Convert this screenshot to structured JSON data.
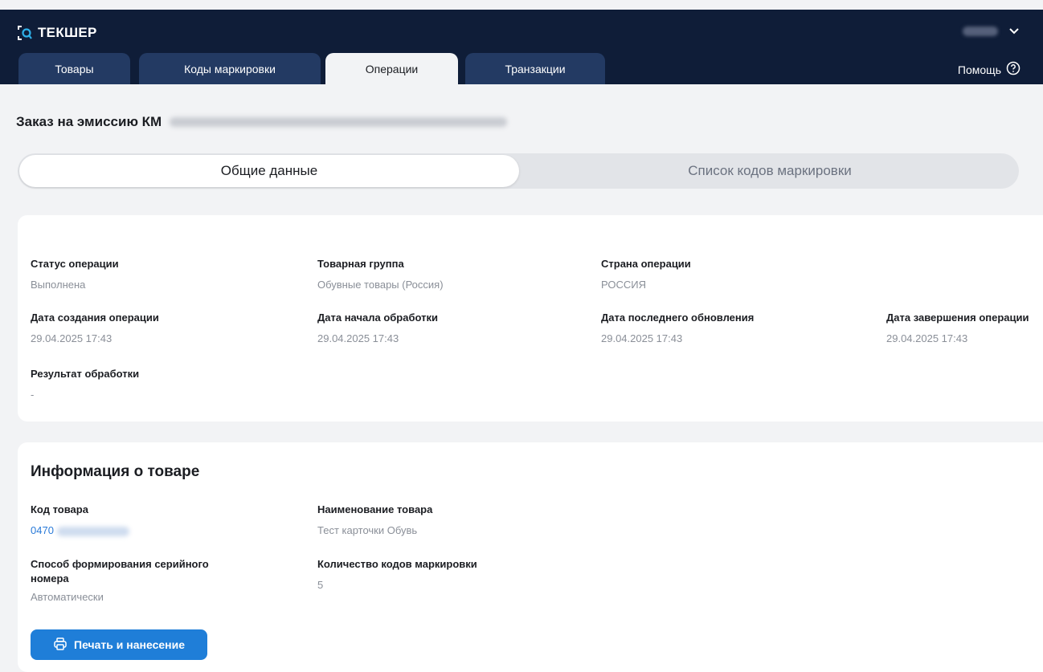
{
  "app": {
    "logo_text": "ТЕКШЕР"
  },
  "user": {
    "name": ""
  },
  "help": {
    "label": "Помощь"
  },
  "tabs": [
    {
      "label": "Товары"
    },
    {
      "label": "Коды маркировки"
    },
    {
      "label": "Операции"
    },
    {
      "label": "Транзакции"
    }
  ],
  "page": {
    "title": "Заказ на эмиссию КМ"
  },
  "segments": {
    "general": "Общие данные",
    "codes": "Список кодов маркировки"
  },
  "general": {
    "status_label": "Статус операции",
    "status_value": "Выполнена",
    "group_label": "Товарная группа",
    "group_value": "Обувные товары (Россия)",
    "country_label": "Страна операции",
    "country_value": "РОССИЯ",
    "created_label": "Дата создания операции",
    "created_value": "29.04.2025 17:43",
    "start_label": "Дата начала обработки",
    "start_value": "29.04.2025 17:43",
    "updated_label": "Дата последнего обновления",
    "updated_value": "29.04.2025 17:43",
    "finished_label": "Дата завершения операции",
    "finished_value": "29.04.2025 17:43",
    "result_label": "Результат обработки",
    "result_value": "-"
  },
  "product": {
    "title": "Информация о товаре",
    "code_label": "Код товара",
    "code_value": "0470",
    "name_label": "Наименование товара",
    "name_value": "Тест карточки Обувь",
    "serial_label": "Способ формирования серийного номера",
    "serial_value": "Автоматически",
    "count_label": "Количество кодов маркировки",
    "count_value": "5",
    "print_button": "Печать и нанесение"
  }
}
